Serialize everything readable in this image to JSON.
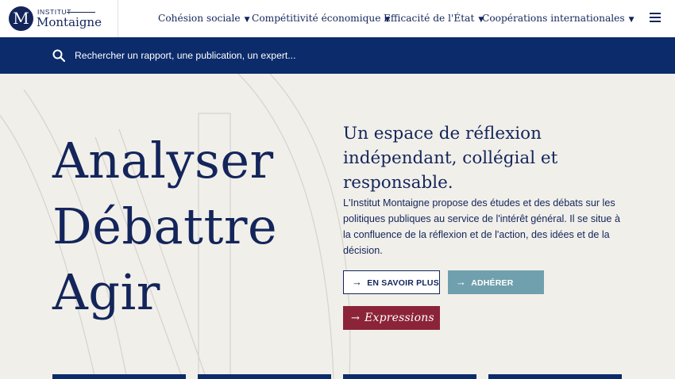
{
  "header": {
    "logo_small": "INSTITUT",
    "logo_big": "Montaigne",
    "logo_letter": "M",
    "nav": [
      {
        "label": "Cohésion sociale",
        "icon": "caret-down-icon"
      },
      {
        "label": "Compétitivité économique",
        "icon": "caret-down-icon"
      },
      {
        "label": "Efficacité de l'État",
        "icon": "caret-down-icon"
      },
      {
        "label": "Coopérations internationales",
        "icon": "caret-down-icon"
      }
    ],
    "caret": "▼",
    "menu_icon": "hamburger-menu-icon"
  },
  "search": {
    "placeholder": "Rechercher un rapport, une publication, un expert...",
    "icon": "search-icon"
  },
  "hero": {
    "line1": "Analyser",
    "line2": "Débattre",
    "line3": "Agir",
    "subtitle": "Un espace de réflexion indépendant, collégial et responsable.",
    "description": "L'Institut Montaigne propose des études et des débats sur les politiques publiques au service de l'intérêt général. Il se situe à la confluence de la réflexion et de l'action, des idées et de la décision."
  },
  "buttons": {
    "arrow": "→",
    "more": "EN SAVOIR PLUS",
    "join": "ADHÉRER",
    "expressions": "Expressions"
  },
  "colors": {
    "navy": "#13255a",
    "search_bar": "#0c2b6b",
    "teal": "#70a0ad",
    "burgundy": "#8b2438",
    "background": "#f1efea"
  }
}
